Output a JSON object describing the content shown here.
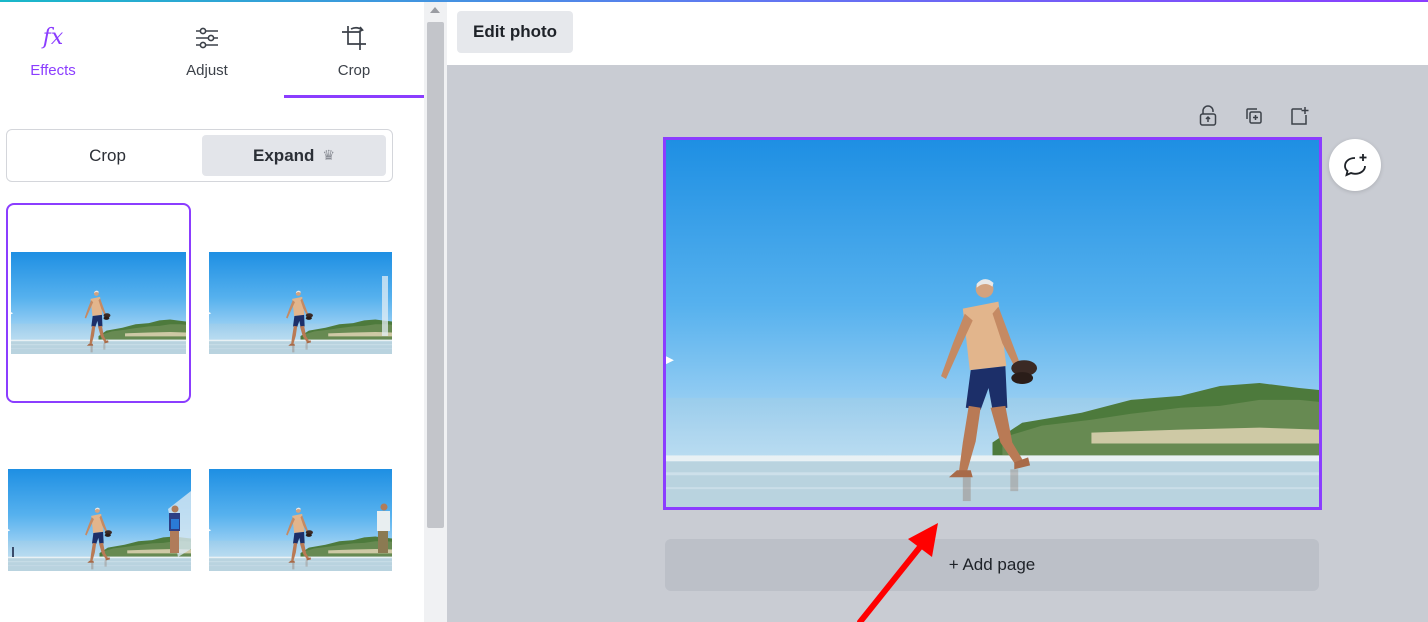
{
  "tabs": [
    {
      "label": "Effects",
      "icon": "fx-icon",
      "active": false
    },
    {
      "label": "Adjust",
      "icon": "sliders-icon",
      "active": false
    },
    {
      "label": "Crop",
      "icon": "crop-icon",
      "active": true
    }
  ],
  "fx_glyph": "fx",
  "segmented": {
    "crop_label": "Crop",
    "expand_label": "Expand",
    "expand_badge": "♛",
    "selected": "Expand"
  },
  "thumbnails": [
    {
      "name": "expand-option-1",
      "selected": true
    },
    {
      "name": "expand-option-2",
      "selected": false
    },
    {
      "name": "expand-option-3",
      "selected": false
    },
    {
      "name": "expand-option-4",
      "selected": false
    }
  ],
  "toolbar": {
    "edit_photo_label": "Edit photo"
  },
  "page_tools": [
    "unlock-icon",
    "duplicate-page-icon",
    "add-page-icon"
  ],
  "canvas": {
    "add_page_label": "+ Add page"
  },
  "colors": {
    "accent": "#8b3dff",
    "canvas_bg": "#c9ccd3",
    "annotation_arrow": "#ff0000"
  }
}
